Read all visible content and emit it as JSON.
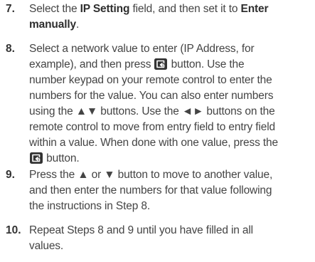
{
  "steps": [
    {
      "number": "7.",
      "segments": [
        {
          "text": "Select the "
        },
        {
          "text": "IP Setting",
          "bold": true
        },
        {
          "text": " field, and then set it to "
        },
        {
          "text": "Enter",
          "bold": true
        },
        {
          "br": true
        },
        {
          "text": "manually",
          "bold": true
        },
        {
          "text": "."
        }
      ]
    },
    {
      "number": "8.",
      "segments": [
        {
          "text": "Select a network value to enter (IP Address, for"
        },
        {
          "br": true
        },
        {
          "text": "example), and then press "
        },
        {
          "icon": "enter-button-icon"
        },
        {
          "text": " button. Use the"
        },
        {
          "br": true
        },
        {
          "text": "number keypad on your remote control to enter the"
        },
        {
          "br": true
        },
        {
          "text": "numbers for the value. You can also enter numbers"
        },
        {
          "br": true
        },
        {
          "text": "using the ▲▼ buttons. Use the ◄► buttons on the"
        },
        {
          "br": true
        },
        {
          "text": "remote control to move from entry field to entry field"
        },
        {
          "br": true
        },
        {
          "text": "within a value. When done with one value, press the"
        },
        {
          "br": true
        },
        {
          "icon": "enter-button-icon"
        },
        {
          "text": " button."
        }
      ]
    },
    {
      "number": "9.",
      "segments": [
        {
          "text": "Press the ▲ or ▼ button to move to another value,"
        },
        {
          "br": true
        },
        {
          "text": "and then enter the numbers for that value following"
        },
        {
          "br": true
        },
        {
          "text": "the instructions in Step 8."
        }
      ]
    },
    {
      "number": "10.",
      "segments": [
        {
          "text": "Repeat Steps 8 and 9 until you have filled in all"
        },
        {
          "br": true
        },
        {
          "text": "values."
        }
      ]
    }
  ]
}
